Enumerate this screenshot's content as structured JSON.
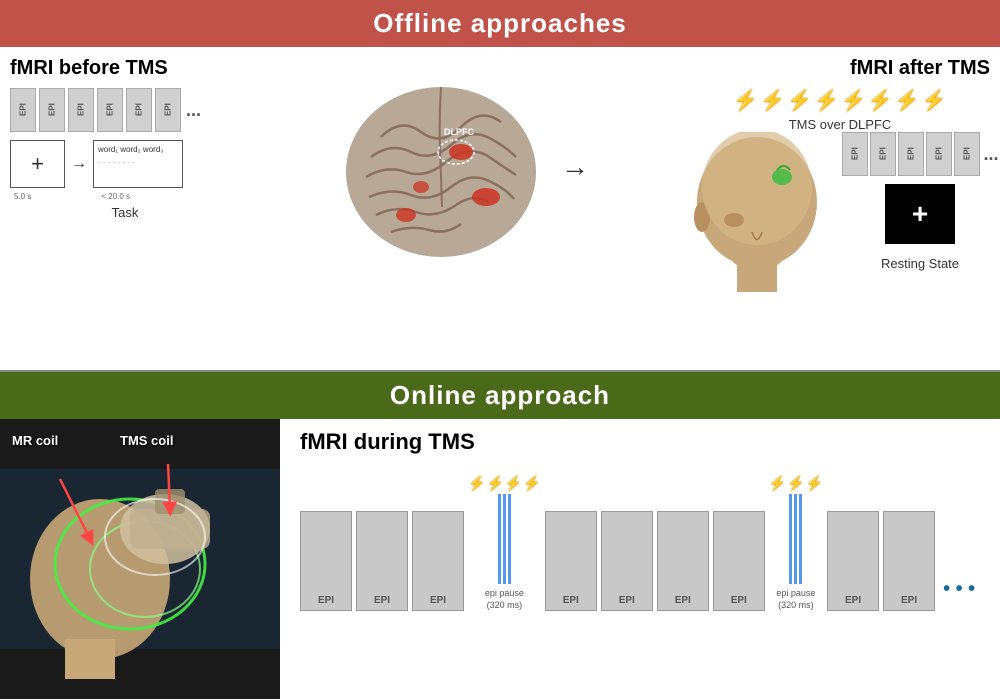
{
  "top": {
    "header": "Offline approaches",
    "left_title": "fMRI before TMS",
    "right_title": "fMRI after TMS",
    "epi_label": "EPI",
    "ellipsis": "...",
    "task_label": "Task",
    "timing_5s": "5.0 s",
    "timing_20s": "< 20.0 s",
    "fixation_cross": "+",
    "word_line": "word₁ word₂ word₃",
    "dashes": "- - - - - - - -",
    "tms_label": "TMS over DLPFC",
    "resting_state": "Resting State",
    "resting_cross": "+",
    "dlpfc_label": "DLPFC"
  },
  "bottom": {
    "header": "Online approach",
    "fmri_title": "fMRI during TMS",
    "mr_coil": "MR coil",
    "tms_coil": "TMS coil",
    "epi_label": "EPI",
    "epi_pause": "epi pause\n(320 ms)",
    "ellipsis": "..."
  },
  "icons": {
    "lightning": "⚡",
    "arrow_right": "→",
    "plus": "+"
  }
}
